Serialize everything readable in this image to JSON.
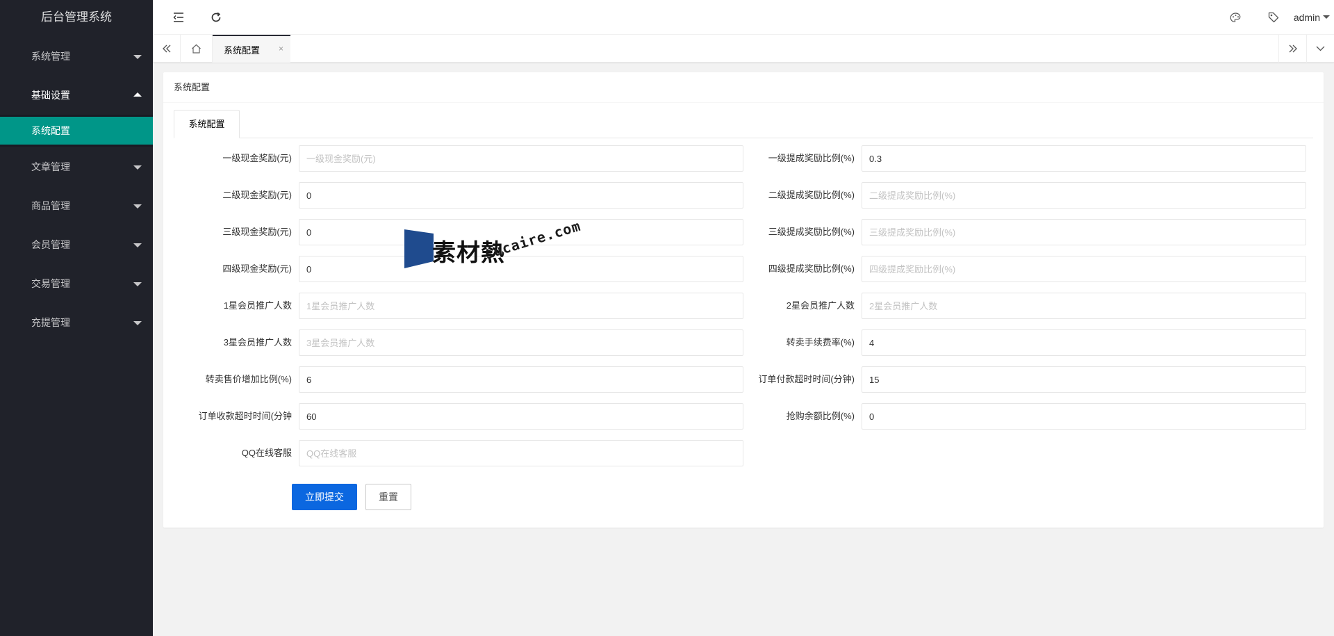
{
  "app": {
    "title": "后台管理系统"
  },
  "sidebar": {
    "items": [
      {
        "label": "系统管理"
      },
      {
        "label": "基础设置"
      },
      {
        "label": "文章管理"
      },
      {
        "label": "商品管理"
      },
      {
        "label": "会员管理"
      },
      {
        "label": "交易管理"
      },
      {
        "label": "充提管理"
      }
    ],
    "submenu": {
      "label": "系统配置"
    }
  },
  "header": {
    "user": "admin",
    "icons": [
      "menu-fold-icon",
      "refresh-icon",
      "theme-palette-icon",
      "tag-icon"
    ]
  },
  "tabs": {
    "active_label": "系统配置",
    "close_glyph": "×"
  },
  "card": {
    "title": "系统配置",
    "tab_label": "系统配置"
  },
  "form": {
    "fields": [
      {
        "label": "一级现金奖励(元)",
        "value": "",
        "placeholder": "一级现金奖励(元)"
      },
      {
        "label": "一级提成奖励比例(%)",
        "value": "0.3",
        "placeholder": "一级提成奖励比例(%)"
      },
      {
        "label": "二级现金奖励(元)",
        "value": "0",
        "placeholder": "二级现金奖励(元)"
      },
      {
        "label": "二级提成奖励比例(%)",
        "value": "",
        "placeholder": "二级提成奖励比例(%)"
      },
      {
        "label": "三级现金奖励(元)",
        "value": "0",
        "placeholder": "三级现金奖励(元)"
      },
      {
        "label": "三级提成奖励比例(%)",
        "value": "",
        "placeholder": "三级提成奖励比例(%)"
      },
      {
        "label": "四级现金奖励(元)",
        "value": "0",
        "placeholder": "四级现金奖励(元)"
      },
      {
        "label": "四级提成奖励比例(%)",
        "value": "",
        "placeholder": "四级提成奖励比例(%)"
      },
      {
        "label": "1星会员推广人数",
        "value": "",
        "placeholder": "1星会员推广人数"
      },
      {
        "label": "2星会员推广人数",
        "value": "",
        "placeholder": "2星会员推广人数"
      },
      {
        "label": "3星会员推广人数",
        "value": "",
        "placeholder": "3星会员推广人数"
      },
      {
        "label": "转卖手续费率(%)",
        "value": "4",
        "placeholder": "转卖手续费率(%)"
      },
      {
        "label": "转卖售价增加比例(%)",
        "value": "6",
        "placeholder": "转卖售价增加比例(%)"
      },
      {
        "label": "订单付款超时时间(分钟)",
        "value": "15",
        "placeholder": "订单付款超时时间(分钟)"
      },
      {
        "label": "订单收款超时时间(分钟",
        "value": "60",
        "placeholder": "订单收款超时时间(分钟"
      },
      {
        "label": "抢购余额比例(%)",
        "value": "0",
        "placeholder": "抢购余额比例(%)"
      },
      {
        "label": "QQ在线客服",
        "value": "",
        "placeholder": "QQ在线客服"
      }
    ],
    "submit_label": "立即提交",
    "reset_label": "重置"
  },
  "watermark": {
    "cn": "素材熱",
    "en": "sucaire.com"
  },
  "colors": {
    "sidebar_bg": "#20222a",
    "active_submenu": "#009688",
    "primary_button": "#0b67e0",
    "page_bg": "#f2f2f2"
  }
}
